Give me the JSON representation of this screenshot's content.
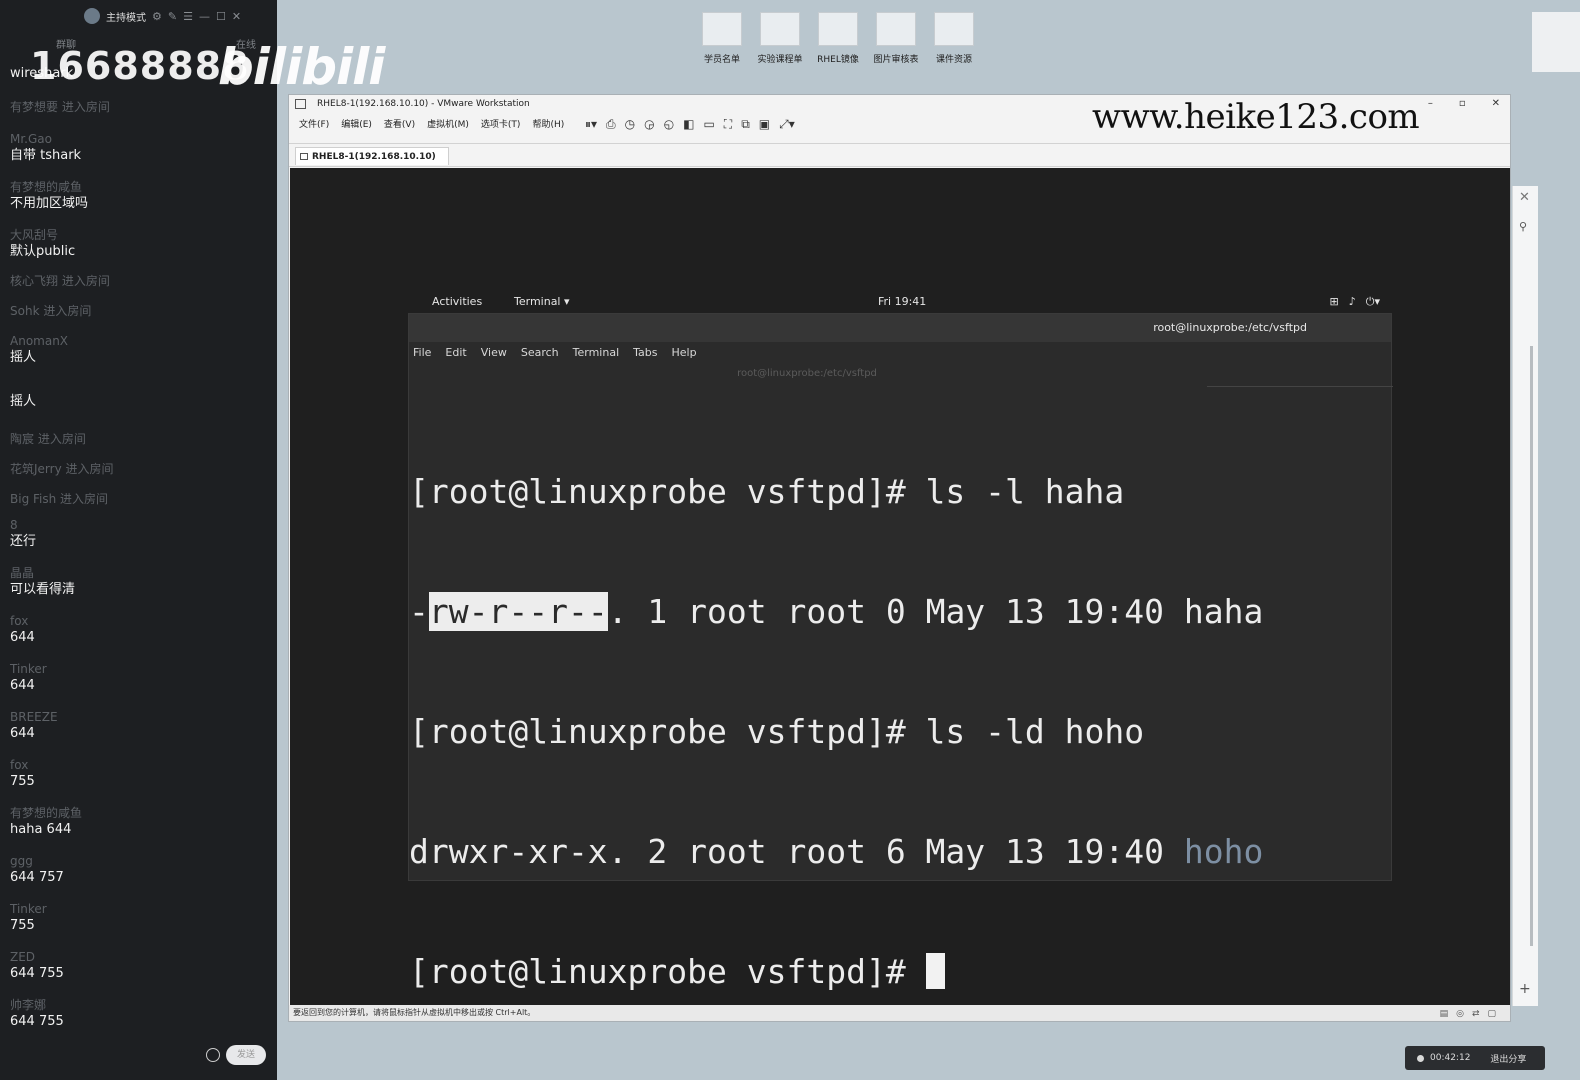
{
  "chat": {
    "mode_label": "主持模式",
    "tabs": [
      "群聊",
      "在线"
    ],
    "watermark_number": "16688888",
    "messages": [
      {
        "who": "",
        "text": "wireshark"
      },
      {
        "who": "有梦想要 进入房间",
        "text": ""
      },
      {
        "who": "Mr.Gao",
        "text": "自带 tshark"
      },
      {
        "who": "有梦想的咸鱼",
        "text": "不用加区域吗"
      },
      {
        "who": "大风刮号",
        "text": "默认public"
      },
      {
        "who": "核心飞翔 进入房间",
        "text": ""
      },
      {
        "who": "Sohk 进入房间",
        "text": ""
      },
      {
        "who": "AnomanX",
        "text": "摇人"
      },
      {
        "who": "",
        "text": "摇人"
      },
      {
        "who": "陶宸 进入房间",
        "text": ""
      },
      {
        "who": "花筑Jerry 进入房间",
        "text": ""
      },
      {
        "who": "Big Fish 进入房间",
        "text": ""
      },
      {
        "who": "8",
        "text": "还行"
      },
      {
        "who": "晶晶",
        "text": "可以看得清"
      },
      {
        "who": "fox",
        "text": "644"
      },
      {
        "who": "Tinker",
        "text": "644"
      },
      {
        "who": "BREEZE",
        "text": "644"
      },
      {
        "who": "fox",
        "text": "755"
      },
      {
        "who": "有梦想的咸鱼",
        "text": "haha 644"
      },
      {
        "who": "ggg",
        "text": "644 757"
      },
      {
        "who": "Tinker",
        "text": "755"
      },
      {
        "who": "ZED",
        "text": "644 755"
      },
      {
        "who": "帅李娜",
        "text": "644  755"
      }
    ],
    "send_label": "发送"
  },
  "brand_logo": "bilibili",
  "desktop_icons": [
    "学员名单",
    "实验课程单",
    "RHEL镜像",
    "图片审核表",
    "课件资源"
  ],
  "vmware": {
    "title": "RHEL8-1(192.168.10.10) - VMware Workstation",
    "menu": [
      "文件(F)",
      "编辑(E)",
      "查看(V)",
      "虚拟机(M)",
      "选项卡(T)",
      "帮助(H)"
    ],
    "site_watermark": "www.heike123.com",
    "vm_tab": "RHEL8-1(192.168.10.10)",
    "status_text": "要返回到您的计算机，请将鼠标指针从虚拟机中移出或按 Ctrl+Alt。"
  },
  "gnome": {
    "activities": "Activities",
    "app_menu": "Terminal ▾",
    "clock": "Fri 19:41"
  },
  "terminal": {
    "title": "root@linuxprobe:/etc/vsftpd",
    "menu": [
      "File",
      "Edit",
      "View",
      "Search",
      "Terminal",
      "Tabs",
      "Help"
    ],
    "tab_title": "root@linuxprobe:/etc/vsftpd",
    "line1": "[root@linuxprobe vsftpd]# ls -l haha",
    "line2_pre": "-",
    "line2_sel": "rw-r--r--",
    "line2_post": ". 1 root root 0 May 13 19:40 haha",
    "line3": "[root@linuxprobe vsftpd]# ls -ld hoho",
    "line4_pre": "drwxr-xr-x. 2 root root 6 May 13 19:40 ",
    "line4_dir": "hoho",
    "line5": "[root@linuxprobe vsftpd]# "
  },
  "share": {
    "timer": "00:42:12",
    "exit_label": "退出分享"
  }
}
